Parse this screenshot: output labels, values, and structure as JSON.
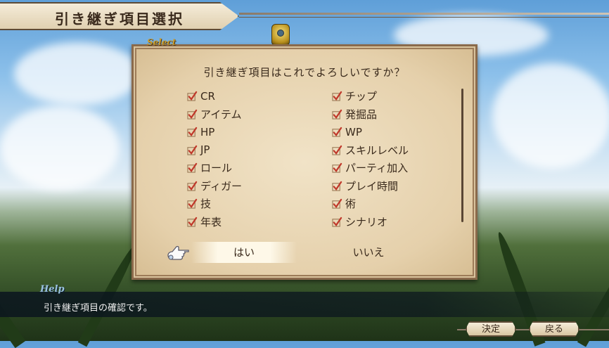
{
  "header": {
    "title": "引き継ぎ項目選択"
  },
  "dialog": {
    "label": "Select",
    "question": "引き継ぎ項目はこれでよろしいですか？",
    "left_items": [
      "CR",
      "アイテム",
      "HP",
      "JP",
      "ロール",
      "ディガー",
      "技",
      "年表"
    ],
    "right_items": [
      "チップ",
      "発掘品",
      "WP",
      "スキルレベル",
      "パーティ加入",
      "プレイ時間",
      "術",
      "シナリオ"
    ],
    "yes_label": "はい",
    "no_label": "いいえ"
  },
  "help": {
    "label": "Help",
    "text": "引き継ぎ項目の確認です。"
  },
  "footer": {
    "confirm_label": "決定",
    "back_label": "戻る"
  },
  "colors": {
    "parchment": "#e5d0ab",
    "ink": "#3a2a1c",
    "check": "#c0392b",
    "frame": "#8a6a4b"
  }
}
